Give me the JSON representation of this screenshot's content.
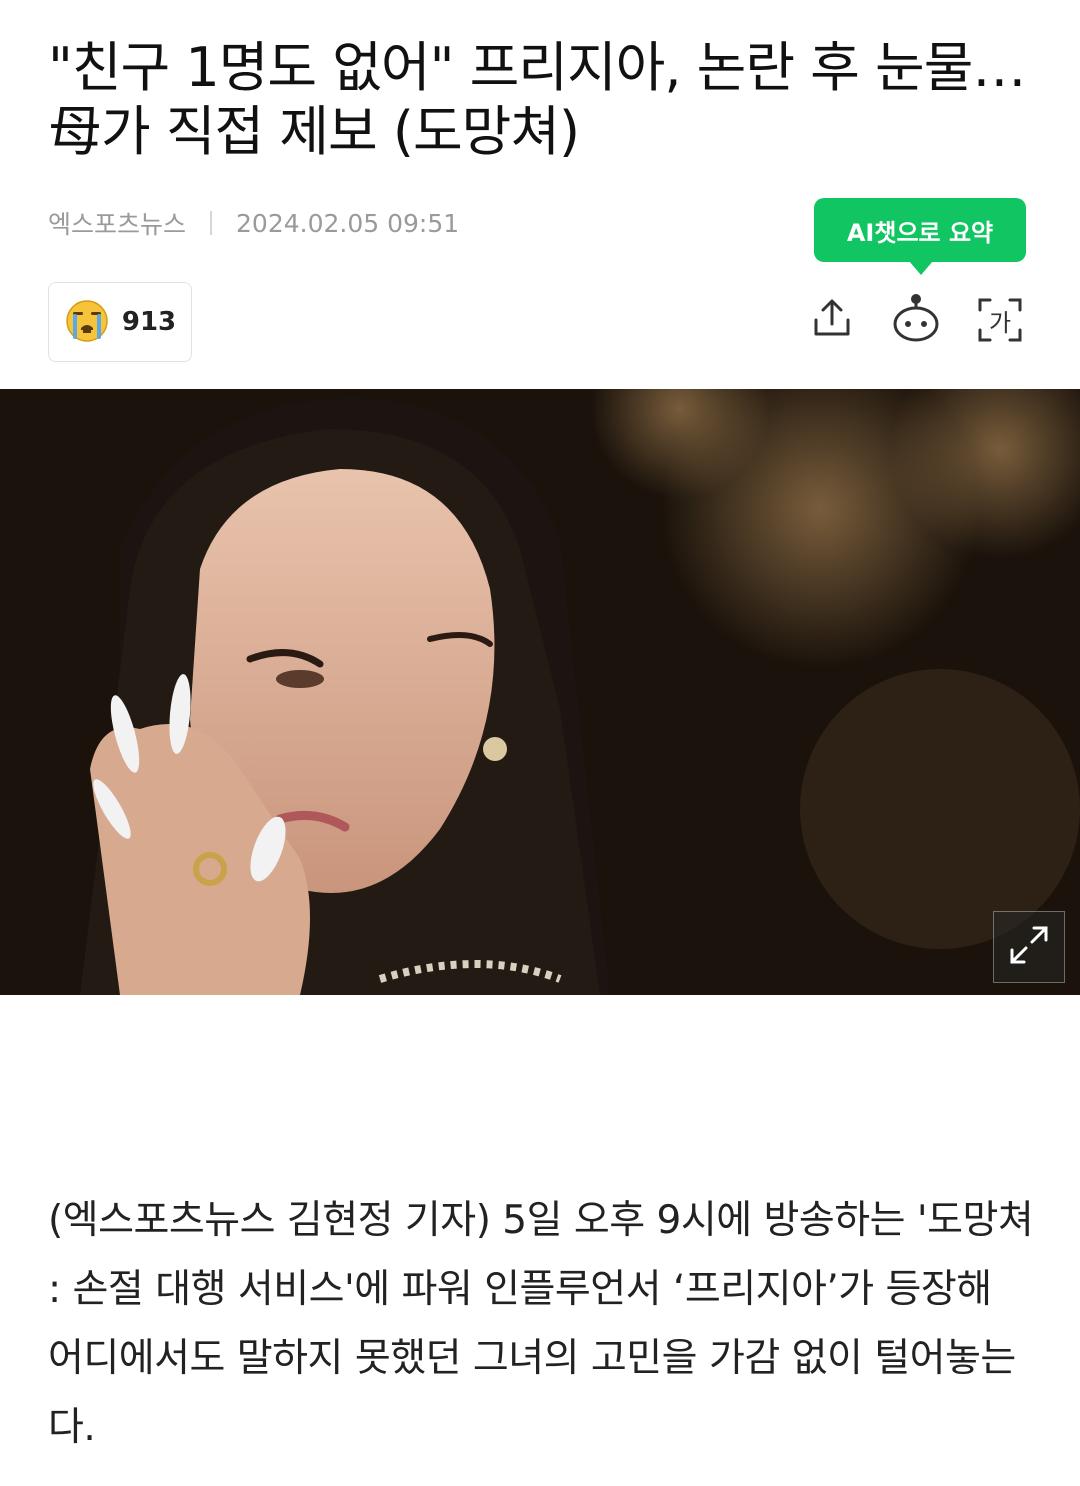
{
  "article": {
    "headline": "\"친구 1명도 없어\" 프리지아, 논란 후 눈물…母가 직접 제보 (도망쳐)",
    "source": "엑스포츠뉴스",
    "datetime": "2024.02.05 09:51",
    "body": "(엑스포츠뉴스 김현정 기자) 5일 오후 9시에 방송하는 '도망쳐 : 손절 대행 서비스'에 파워 인플루언서 ‘프리지아’가 등장해 어디에서도 말하지 못했던 그녀의 고민을 가감 없이 털어놓는다."
  },
  "ai_summary": {
    "label": "AI챗으로 요약",
    "color": "#12c563"
  },
  "reaction": {
    "icon": "crying-face-icon",
    "count": "913"
  },
  "toolbar": {
    "share_icon": "share-icon",
    "ai_bot_icon": "robot-icon",
    "font_size_icon": "font-size-icon",
    "font_size_glyph": "가"
  },
  "hero_image": {
    "subject": "woman-wiping-tears-photo",
    "expand_icon": "expand-icon"
  }
}
